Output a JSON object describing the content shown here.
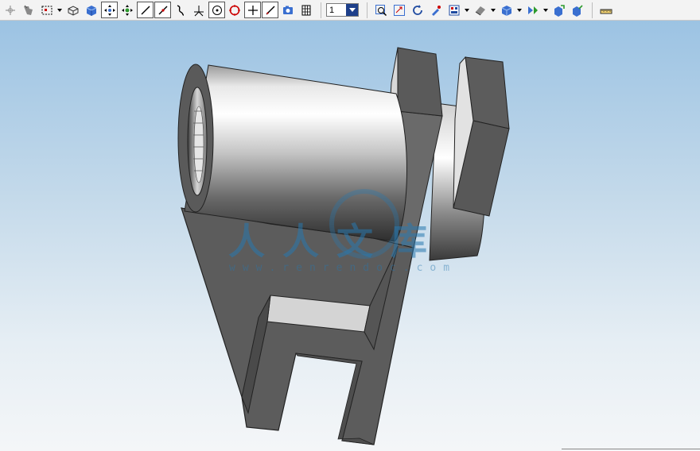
{
  "toolbar": {
    "buttons": [
      {
        "name": "snap-point-icon"
      },
      {
        "name": "selection-filter-icon"
      },
      {
        "name": "select-rectangle-icon",
        "dropdown": true
      },
      {
        "name": "view-box-outline-icon"
      },
      {
        "name": "view-solid-cube-icon"
      },
      {
        "name": "pan-arrows-icon",
        "boxed": true
      },
      {
        "name": "rotate-arrows-icon"
      },
      {
        "name": "line-icon",
        "boxed": true
      },
      {
        "name": "line-tangent-icon",
        "boxed": true
      },
      {
        "name": "curve-icon"
      },
      {
        "name": "angle-icon"
      },
      {
        "name": "circle-center-icon",
        "boxed": true
      },
      {
        "name": "circle-red-icon"
      },
      {
        "name": "cross-hair-icon",
        "boxed": true
      },
      {
        "name": "diagonal-line-icon",
        "boxed": true
      },
      {
        "name": "camera-icon"
      },
      {
        "name": "grid-icon"
      }
    ],
    "layer_select": {
      "value": "1"
    },
    "view_buttons": [
      {
        "name": "zoom-window-icon"
      },
      {
        "name": "zoom-fit-icon"
      },
      {
        "name": "rotate-view-icon"
      },
      {
        "name": "paint-icon"
      },
      {
        "name": "layout-icon",
        "dropdown": true
      },
      {
        "name": "shading-icon",
        "dropdown": true
      },
      {
        "name": "cube-view-icon",
        "dropdown": true
      },
      {
        "name": "transform-icon",
        "dropdown": true
      },
      {
        "name": "export-icon"
      },
      {
        "name": "import-icon"
      },
      {
        "name": "ruler-icon"
      }
    ]
  },
  "watermark": {
    "text": "人人文库",
    "url": "www.renrendoc.com"
  },
  "colors": {
    "accent_blue": "#1d3f8a",
    "model_dark": "#5a5a5a",
    "model_light": "#d8d8d8"
  }
}
